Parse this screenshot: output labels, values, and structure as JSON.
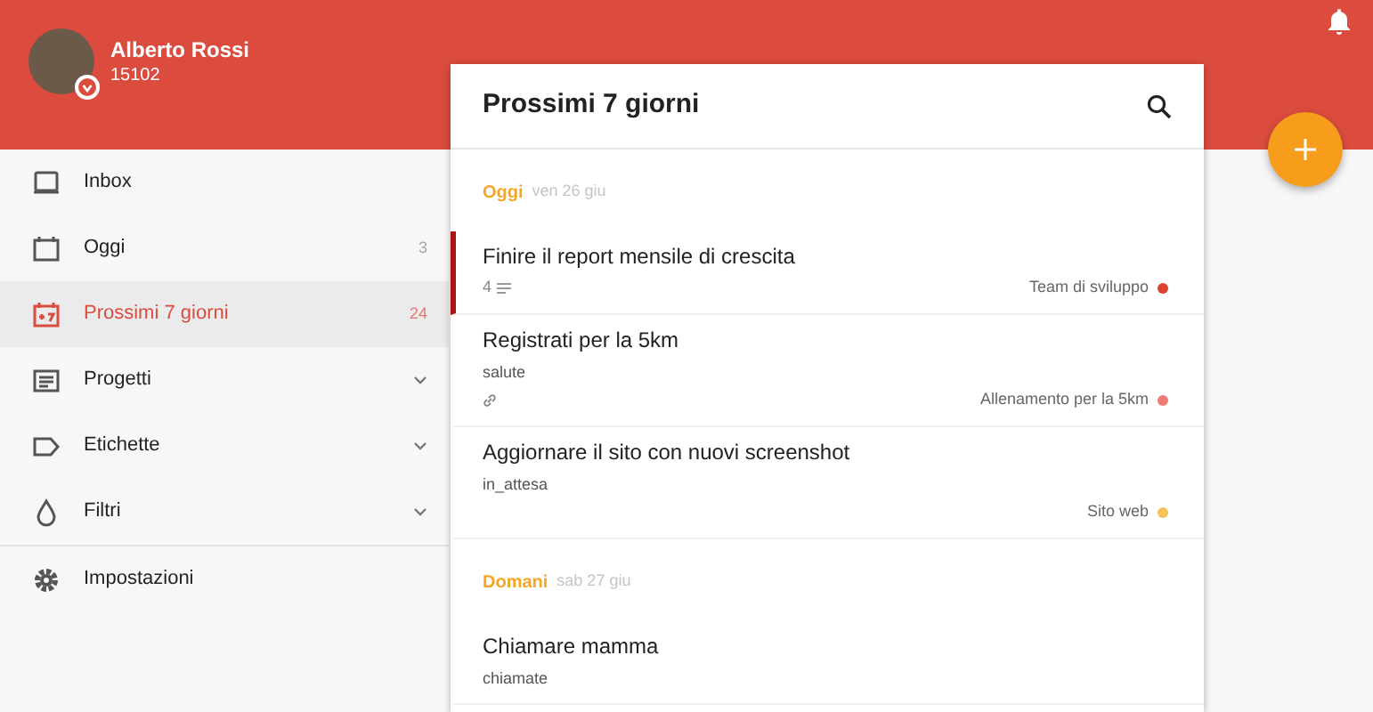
{
  "user": {
    "name": "Alberto Rossi",
    "karma": "15102"
  },
  "sidebar": {
    "items": [
      {
        "kind": "inbox",
        "label": "Inbox",
        "selected": false
      },
      {
        "kind": "today",
        "label": "Oggi",
        "count": "3",
        "selected": false
      },
      {
        "kind": "week",
        "label": "Prossimi 7 giorni",
        "count": "24",
        "selected": true
      },
      {
        "kind": "projects",
        "label": "Progetti",
        "expandable": true,
        "selected": false
      },
      {
        "kind": "labels",
        "label": "Etichette",
        "expandable": true,
        "selected": false
      },
      {
        "kind": "filters",
        "label": "Filtri",
        "expandable": true,
        "selected": false
      },
      {
        "kind": "settings",
        "label": "Impostazioni",
        "divider_before": true,
        "selected": false
      }
    ]
  },
  "main": {
    "title": "Prossimi 7 giorni",
    "sections": [
      {
        "day": "Oggi",
        "date": "ven 26 giu",
        "tasks": [
          {
            "title": "Finire il report mensile di crescita",
            "comments": "4",
            "priority": true,
            "project": "Team di sviluppo",
            "color": "#d9442f"
          },
          {
            "title": "Registrati per la 5km",
            "label": "salute",
            "link": true,
            "priority": false,
            "project": "Allenamento per la 5km",
            "color": "#f07a74"
          },
          {
            "title": "Aggiornare il sito con nuovi screenshot",
            "label": "in_attesa",
            "priority": false,
            "project": "Sito web",
            "color": "#f5c15a"
          }
        ]
      },
      {
        "day": "Domani",
        "date": "sab 27 giu",
        "tasks": [
          {
            "title": "Chiamare mamma",
            "label": "chiamate",
            "priority": false
          }
        ]
      }
    ]
  }
}
